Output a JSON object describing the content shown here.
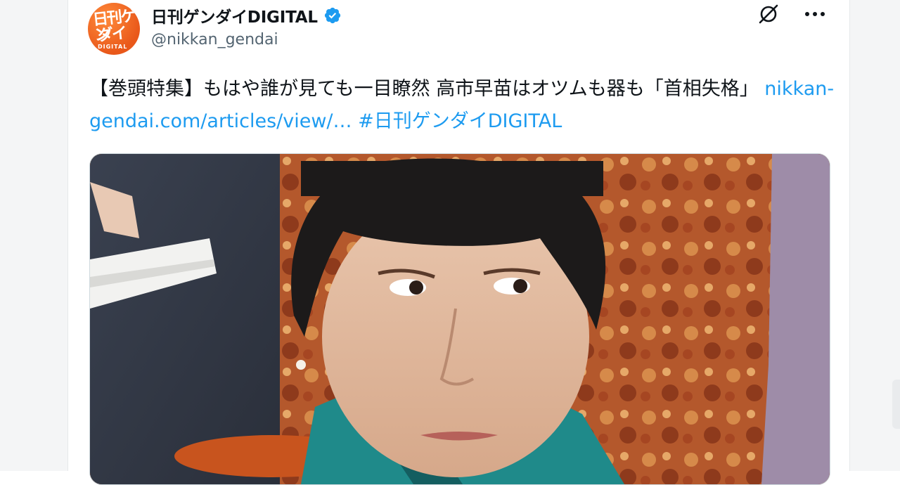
{
  "account": {
    "display_name": "日刊ゲンダイDIGITAL",
    "handle": "@nikkan_gendai",
    "verified": true,
    "avatar_logo": {
      "line1": "日刊ゲン",
      "line2": "ダイ",
      "line3": "DIGITAL"
    }
  },
  "header_icons": [
    "grok-icon",
    "more-icon"
  ],
  "tweet": {
    "text": "【巻頭特集】もはや誰が見ても一目瞭然 高市早苗はオツムも器も「首相失格」 ",
    "link": "nikkan-gendai.com/articles/view/…",
    "hashtag": "#日刊ゲンダイDIGITAL"
  },
  "colors": {
    "accent": "#1d9bf0",
    "text": "#0f1419",
    "muted": "#536471",
    "avatar": "#ec5f1e"
  }
}
